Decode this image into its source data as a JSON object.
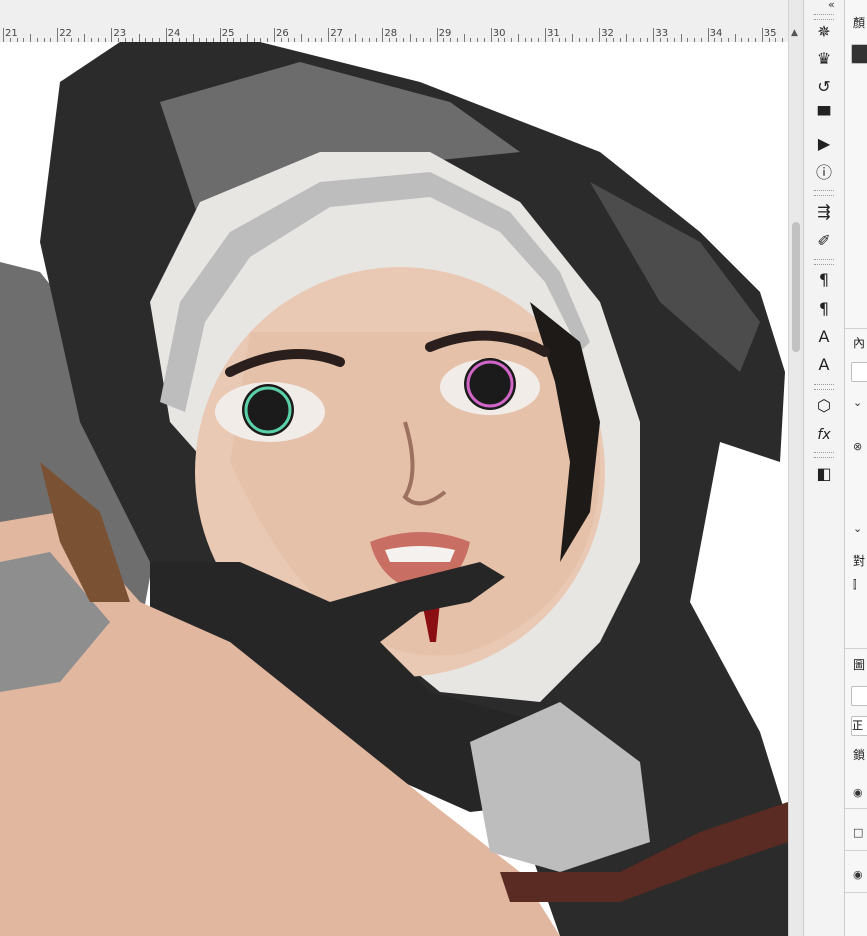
{
  "ruler": {
    "labels": [
      "21",
      "22",
      "23",
      "24",
      "25",
      "26",
      "27",
      "28",
      "29",
      "30",
      "31",
      "32",
      "33",
      "34",
      "35"
    ]
  },
  "canvas": {
    "artwork": "digital-painting-nun"
  },
  "toolbar": {
    "tools": [
      {
        "icon": "navigator-icon",
        "glyph": "✵"
      },
      {
        "icon": "brush-settings-icon",
        "glyph": "♛"
      },
      {
        "icon": "history-icon",
        "glyph": "↺"
      },
      {
        "icon": "comment-icon",
        "glyph": "▀"
      },
      {
        "icon": "play-icon",
        "glyph": "▶"
      },
      {
        "icon": "info-icon",
        "glyph": "ⓘ"
      },
      {
        "icon": "brush-slider-icon",
        "glyph": "⇶"
      },
      {
        "icon": "brush-preset-icon",
        "glyph": "✐"
      },
      {
        "icon": "paragraph-icon",
        "glyph": "¶"
      },
      {
        "icon": "paragraph-style-icon",
        "glyph": "¶"
      },
      {
        "icon": "character-icon",
        "glyph": "A"
      },
      {
        "icon": "character-style-icon",
        "glyph": "A"
      },
      {
        "icon": "3d-icon",
        "glyph": "⬡"
      },
      {
        "icon": "fx-icon",
        "glyph": "fx"
      },
      {
        "icon": "layer-comp-icon",
        "glyph": "◧"
      }
    ]
  },
  "right_panel": {
    "color_title": "顏",
    "properties_title": "內",
    "align_label": "對",
    "layers_title": "圖",
    "blend_mode": "正",
    "lock_label": "鎖"
  }
}
